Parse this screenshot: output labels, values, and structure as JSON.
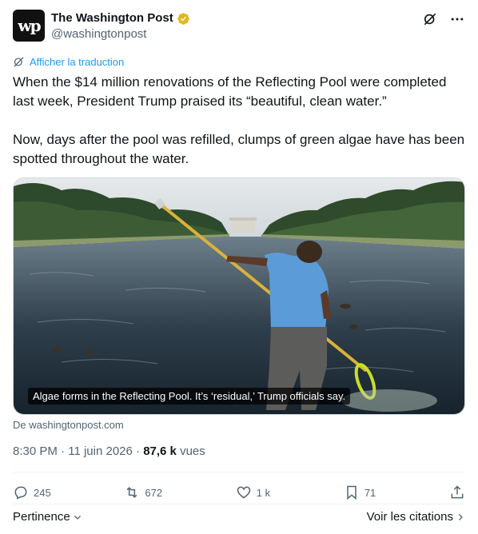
{
  "header": {
    "avatar_text": "wp",
    "display_name": "The Washington Post",
    "handle": "@washingtonpost",
    "grok_icon": "grok-icon",
    "more_icon": "more-icon"
  },
  "translate": {
    "label": "Afficher la traduction",
    "icon": "translate-icon"
  },
  "tweet": {
    "paragraph1": "When the $14 million renovations of the Reflecting Pool were completed last week, President Trump praised its “beautiful, clean water.”",
    "paragraph2": "Now, days after the pool was refilled, clumps of green algae have has been spotted throughout the water."
  },
  "media": {
    "caption": "Algae forms in the Reflecting Pool. It’s ‘residual,’ Trump officials say."
  },
  "source": "De washingtonpost.com",
  "meta": {
    "time": "8:30 PM",
    "sep1": " · ",
    "date": "11 juin 2026",
    "sep2": " · ",
    "views_count": "87,6 k",
    "views_label": " vues"
  },
  "actions": {
    "replies": "245",
    "reposts": "672",
    "likes": "1 k",
    "bookmarks": "71"
  },
  "footer": {
    "sort_label": "Pertinence",
    "quotes_label": "Voir les citations"
  },
  "colors": {
    "accent": "#1d9bf0",
    "secondary_text": "#536471",
    "verified_gold": "#e2b719"
  }
}
